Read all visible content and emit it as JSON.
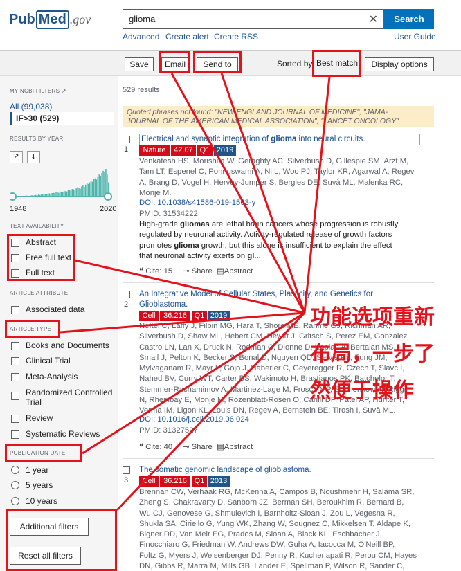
{
  "header": {
    "logo_pub": "Pub",
    "logo_med": "Med",
    "logo_gov": ".gov",
    "search_value": "glioma",
    "clear_glyph": "✕",
    "search_button": "Search",
    "links": {
      "advanced": "Advanced",
      "create_alert": "Create alert",
      "create_rss": "Create RSS",
      "user_guide": "User Guide"
    }
  },
  "toolbar": {
    "save": "Save",
    "email": "Email",
    "send_to": "Send to",
    "sorted_by": "Sorted by",
    "best_match": "Best match",
    "display_options": "Display options"
  },
  "sidebar": {
    "my_filters": "MY NCBI FILTERS",
    "all": "All (99,038)",
    "if_filter": "IF>30 (529)",
    "results_by_year": "RESULTS BY YEAR",
    "year_start": "1948",
    "year_end": "2020",
    "text_availability": "TEXT AVAILABILITY",
    "text_options": [
      "Abstract",
      "Free full text",
      "Full text"
    ],
    "article_attribute": "ARTICLE ATTRIBUTE",
    "associated_data": "Associated data",
    "article_type": "ARTICLE TYPE",
    "type_options": [
      "Books and Documents",
      "Clinical Trial",
      "Meta-Analysis",
      "Randomized Controlled",
      "Trial",
      "Review",
      "Systematic Reviews"
    ],
    "publication_date": "PUBLICATION DATE",
    "date_options": [
      "1 year",
      "5 years",
      "10 years"
    ],
    "additional_filters": "Additional filters",
    "reset_filters": "Reset all filters",
    "histogram": [
      1,
      1,
      1,
      1,
      1,
      2,
      1,
      2,
      2,
      2,
      3,
      3,
      2,
      3,
      4,
      3,
      4,
      5,
      4,
      6,
      5,
      6,
      7,
      6,
      8,
      7,
      9,
      10,
      9,
      11,
      12,
      11,
      14,
      13,
      12,
      16,
      15,
      14,
      18,
      17,
      16,
      20,
      22,
      19,
      24,
      23,
      21,
      26,
      30,
      27,
      25,
      32,
      35,
      31,
      38,
      42,
      40,
      45,
      50,
      47,
      55,
      58,
      54,
      62,
      70,
      66,
      75,
      82,
      78,
      88,
      70,
      45
    ]
  },
  "results": {
    "count": "529 results",
    "notice_line1": "Quoted phrases not found: \"NEW ENGLAND JOURNAL OF MEDICINE\", \"JAMA-",
    "notice_line2": "JOURNAL OF THE AMERICAN MEDICAL ASSOCIATION\", \"LANCET ONCOLOGY\"",
    "items": [
      {
        "num": "1",
        "title_pre": "Electrical and synaptic integration of ",
        "title_bold": "glioma",
        "title_post": " into neural circuits.",
        "journal": "Nature",
        "if": "42.07",
        "q": "Q1",
        "year": "2019",
        "authors": [
          "Venkatesh HS, Morishita W, Geraghty AC, Silverbush D, Gillespie SM, Arzt M,",
          "Tam LT, Espenel C, Ponnuswami A, Ni L, Woo PJ, Taylor KR, Agarwal A, Regev",
          "A, Brang D, Vogel H, Hervey-Jumper S, Bergles DE, Suvà ML, Malenka RC,",
          "Monje M."
        ],
        "doi": "DOI: 10.1038/s41586-019-1563-y",
        "pmid": "PMID: 31534222",
        "snippet_1a": "High-grade ",
        "snippet_1b": "gliomas",
        "snippet_1c": " are lethal brain cancers whose progression is robustly",
        "snippet_2": "regulated by neuronal activity. Activity-regulated release of growth factors",
        "snippet_3a": "promotes ",
        "snippet_3b": "glioma",
        "snippet_3c": " growth, but this alone is insufficient to explain the effect",
        "snippet_4a": "that neuronal activity exerts on ",
        "snippet_4b": "gl",
        "snippet_4c": "...",
        "cite": "Cite: 15",
        "share": "Share",
        "abstract": "Abstract"
      },
      {
        "num": "2",
        "title_line1": "An Integrative Model of Cellular States, Plasticity, and Genetics for",
        "title_line2": "Glioblastoma.",
        "journal": "Cell",
        "if": "36.216",
        "q": "Q1",
        "year": "2019",
        "authors": [
          "Neftel C, Laffy J, Filbin MG, Hara T, Shore ME, Rahme GJ, Richman AR,",
          "Silverbush D, Shaw ML, Hebert CM, Dewitt J, Gritsch S, Perez EM, Gonzalez",
          "Castro LN, Lan X, Druck N, Rodman C, Dionne D, Kaplan A, Bertalan MS,",
          "Small J, Pelton K, Becker S, Bonal D, Nguyen QD, Servis RL, Fung JM,",
          "Mylvaganam R, Mayr L, Gojo J, Haberler C, Geyeregger R, Czech T, Slavc I,",
          "Nahed BV, Curry WT, Carter BS, Wakimoto H, Brastianos PK, Batchelor T,",
          "Stemmer-Rachamimov A, Martinez-Lage M, Frosch MP, Stamenkovic I, Riggi",
          "N, Rheinbay E, Monje M, Rozenblatt-Rosen O, Cahill DP, Patel AP, Hunter T,",
          "Verma IM, Ligon KL, Louis DN, Regev A, Bernstein BE, Tirosh I, Suvà ML."
        ],
        "doi": "DOI: 10.1016/j.cell.2019.06.024",
        "pmid": "PMID: 31327527",
        "cite": "Cite: 40",
        "share": "Share",
        "abstract": "Abstract"
      },
      {
        "num": "3",
        "title": "The somatic genomic landscape of glioblastoma.",
        "journal": "Cell",
        "if": "36.216",
        "q": "Q1",
        "year": "2013",
        "authors": [
          "Brennan CW, Verhaak RG, McKenna A, Campos B, Noushmehr H, Salama SR,",
          "Zheng S, Chakravarty D, Sanborn JZ, Berman SH, Beroukhim R, Bernard B,",
          "Wu CJ, Genovese G, Shmulevich I, Barnholtz-Sloan J, Zou L, Vegesna R,",
          "Shukla SA, Ciriello G, Yung WK, Zhang W, Sougnez C, Mikkelsen T, Aldape K,",
          "Bigner DD, Van Meir EG, Prados M, Sloan A, Black KL, Eschbacher J,",
          "Finocchiaro G, Friedman W, Andrews DW, Guha A, Iacocca M, O'Neill BP,",
          "Foltz G, Myers J, Weisenberger DJ, Penny R, Kucherlapati R, Perou CM, Hayes",
          "DN, Gibbs R, Marra M, Mills GB, Lander E, Spellman P, Wilson R, Sander C,"
        ]
      }
    ]
  },
  "annotation": {
    "line1": "功能选项重新",
    "line2": "布局，一步了",
    "line3": "然便于操作",
    "color": "#e3121b"
  }
}
